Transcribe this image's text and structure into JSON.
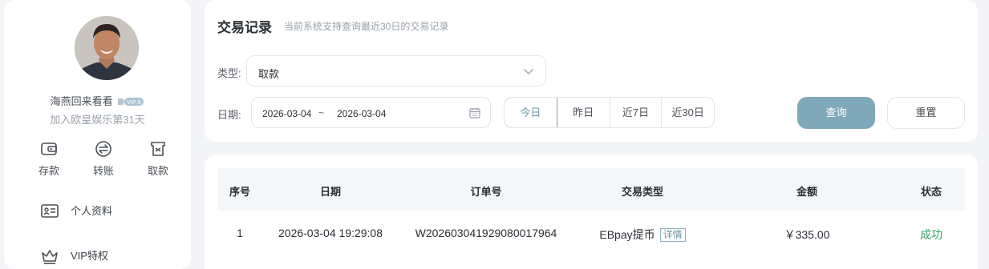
{
  "profile": {
    "username": "海燕回来看看",
    "vip_label": "VIP 0",
    "join_text": "加入欧皇娱乐第31天"
  },
  "quick_actions": [
    {
      "label": "存款",
      "icon": "wallet-icon"
    },
    {
      "label": "转账",
      "icon": "transfer-icon"
    },
    {
      "label": "取款",
      "icon": "withdraw-icon"
    }
  ],
  "menu": [
    {
      "label": "个人资料",
      "icon": "id-card-icon"
    },
    {
      "label": "VIP特权",
      "icon": "crown-icon"
    }
  ],
  "filter": {
    "title": "交易记录",
    "subtitle": "当前系统支持查询最近30日的交易记录",
    "type_label": "类型:",
    "type_value": "取款",
    "date_label": "日期:",
    "date_start": "2026-03-04",
    "date_sep": "~",
    "date_end": "2026-03-04",
    "ranges": [
      "今日",
      "昨日",
      "近7日",
      "近30日"
    ],
    "active_range": "今日",
    "query_label": "查询",
    "reset_label": "重置"
  },
  "table": {
    "headers": [
      "序号",
      "日期",
      "订单号",
      "交易类型",
      "金额",
      "状态"
    ],
    "rows": [
      {
        "index": "1",
        "date": "2026-03-04 19:29:08",
        "order_no": "W202603041929080017964",
        "type": "EBpay提币",
        "detail": "详情",
        "amount": "￥335.00",
        "status": "成功"
      }
    ]
  },
  "colors": {
    "accent": "#7fa9b8",
    "success": "#35a56c",
    "background": "#f2f4f7"
  }
}
